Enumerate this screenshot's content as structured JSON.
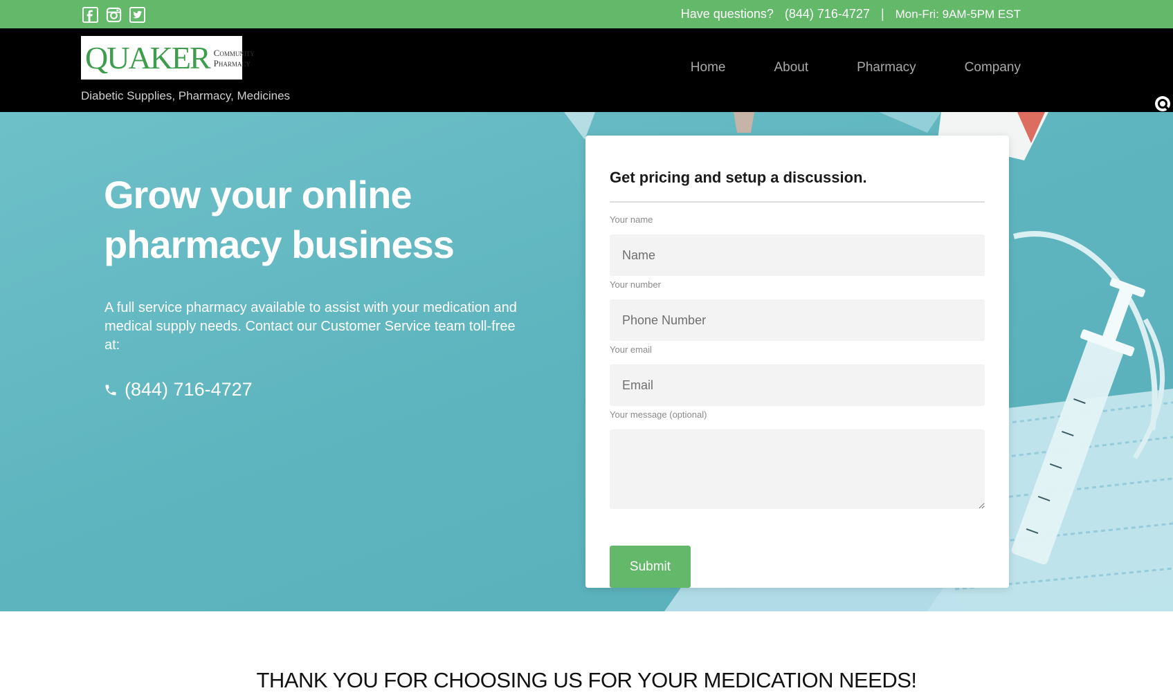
{
  "topbar": {
    "social": [
      "facebook-icon",
      "instagram-icon",
      "twitter-icon"
    ],
    "question": "Have questions?",
    "phone": "(844) 716-4727",
    "separator": "|",
    "hours": "Mon-Fri: 9AM-5PM EST"
  },
  "header": {
    "logo_main": "QUAKER",
    "logo_sub_1": "Community",
    "logo_sub_2": "Pharmacy",
    "tagline": "Diabetic Supplies, Pharmacy, Medicines",
    "nav": [
      "Home",
      "About",
      "Pharmacy",
      "Company"
    ]
  },
  "hero": {
    "title": "Grow your online pharmacy business",
    "description": "A full service pharmacy available to assist with your medication and medical supply needs. Contact our Customer Service team toll-free at:",
    "phone": "(844) 716-4727"
  },
  "form": {
    "title": "Get pricing and setup a discussion.",
    "name_label": "Your name",
    "name_placeholder": "Name",
    "number_label": "Your number",
    "number_placeholder": "Phone Number",
    "email_label": "Your email",
    "email_placeholder": "Email",
    "message_label": "Your message (optional)",
    "submit_label": "Submit"
  },
  "thanks": "THANK YOU FOR CHOOSING US FOR YOUR MEDICATION NEEDS!",
  "colors": {
    "accent_green": "#63b86a",
    "header_black": "#000000",
    "hero_teal": "#5fb5bf"
  }
}
